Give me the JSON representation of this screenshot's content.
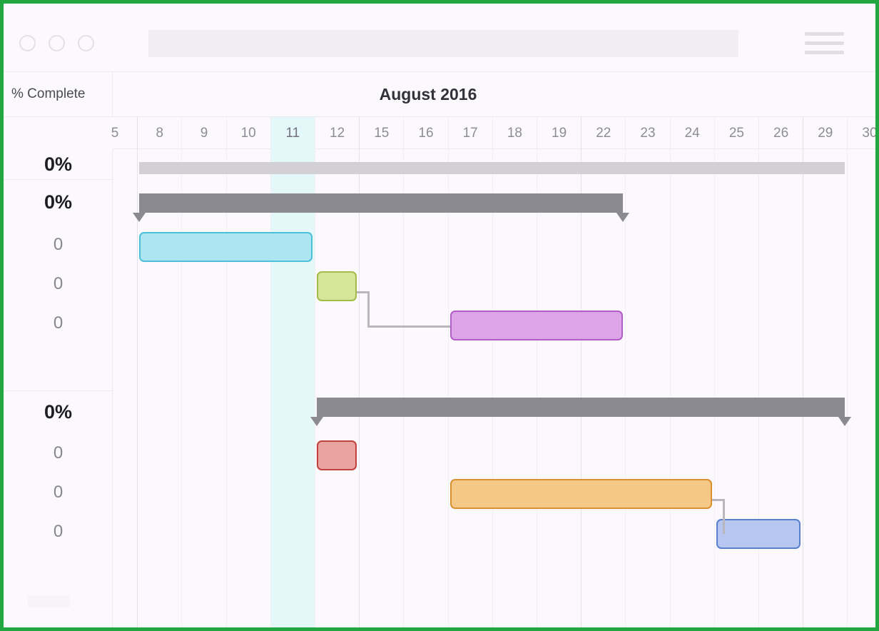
{
  "window": {
    "traffic_lights": [
      "close-dot",
      "minimize-dot",
      "maximize-dot"
    ],
    "search_value": "",
    "search_placeholder": "",
    "menu_icon": "hamburger-menu-icon"
  },
  "header": {
    "percent_column_label": "% Complete",
    "month_title": "August 2016"
  },
  "timeline": {
    "days": [
      "5",
      "8",
      "9",
      "10",
      "11",
      "12",
      "15",
      "16",
      "17",
      "18",
      "19",
      "22",
      "23",
      "24",
      "25",
      "26",
      "29",
      "30"
    ],
    "today_index": 4,
    "today_label": "11",
    "major_separator_after": [
      "5",
      "12",
      "19",
      "26"
    ]
  },
  "rows": [
    {
      "type": "summary",
      "percent": "0%"
    },
    {
      "type": "summary",
      "percent": "0%"
    },
    {
      "type": "task",
      "percent": "0"
    },
    {
      "type": "task",
      "percent": "0"
    },
    {
      "type": "task",
      "percent": "0"
    },
    {
      "type": "spacer",
      "percent": ""
    },
    {
      "type": "summary",
      "percent": "0%"
    },
    {
      "type": "task",
      "percent": "0"
    },
    {
      "type": "task",
      "percent": "0"
    },
    {
      "type": "task",
      "percent": "0"
    }
  ],
  "chart_data": {
    "type": "gantt",
    "title": "August 2016",
    "xlabel": "",
    "ylabel": "% Complete",
    "categories": [
      "5",
      "8",
      "9",
      "10",
      "11",
      "12",
      "15",
      "16",
      "17",
      "18",
      "19",
      "22",
      "23",
      "24",
      "25",
      "26",
      "29",
      "30"
    ],
    "tasks": [
      {
        "id": "project-summary",
        "kind": "summary-light",
        "percent": "0%",
        "start_day": "8",
        "end_day": "29",
        "fill": "#d2d0d5",
        "border": "#d2d0d5"
      },
      {
        "id": "phase-1-summary",
        "kind": "summary",
        "percent": "0%",
        "start_day": "8",
        "end_day": "22",
        "fill": "#8a8a90",
        "border": "#8a8a90"
      },
      {
        "id": "task-a",
        "kind": "task",
        "percent": "0",
        "start_day": "8",
        "end_day": "11",
        "fill": "#aee5f2",
        "border": "#4cc0d6"
      },
      {
        "id": "task-b",
        "kind": "task",
        "percent": "0",
        "start_day": "12",
        "end_day": "12",
        "fill": "#d6e59a",
        "border": "#a2bc48"
      },
      {
        "id": "task-c",
        "kind": "task",
        "percent": "0",
        "start_day": "17",
        "end_day": "22",
        "fill": "#dba5e8",
        "border": "#b65cc9"
      },
      {
        "id": "phase-2-summary",
        "kind": "summary",
        "percent": "0%",
        "start_day": "12",
        "end_day": "29",
        "fill": "#8a8a90",
        "border": "#8a8a90"
      },
      {
        "id": "task-d",
        "kind": "task",
        "percent": "0",
        "start_day": "12",
        "end_day": "12",
        "fill": "#e9a3a0",
        "border": "#c1413d"
      },
      {
        "id": "task-e",
        "kind": "task",
        "percent": "0",
        "start_day": "17",
        "end_day": "24",
        "fill": "#f6c887",
        "border": "#d9912f"
      },
      {
        "id": "task-f",
        "kind": "task",
        "percent": "0",
        "start_day": "25",
        "end_day": "26",
        "fill": "#b6c6f0",
        "border": "#5a7fce"
      }
    ],
    "dependencies": [
      {
        "from": "task-b",
        "to": "task-c",
        "style": "finish-to-start"
      },
      {
        "from": "task-e",
        "to": "task-f",
        "style": "finish-to-start"
      }
    ],
    "today_marker": "11",
    "grid": true,
    "legend": "none"
  },
  "colors": {
    "accent_border": "#22a63f",
    "background": "#fbf9fc",
    "gridline": "#f1eff3",
    "gridline_major": "#e4e1e8",
    "today_band": "#e4f7f9",
    "summary_dark": "#8a8a90",
    "summary_light": "#d2d0d5",
    "link": "#b9b7bd"
  }
}
